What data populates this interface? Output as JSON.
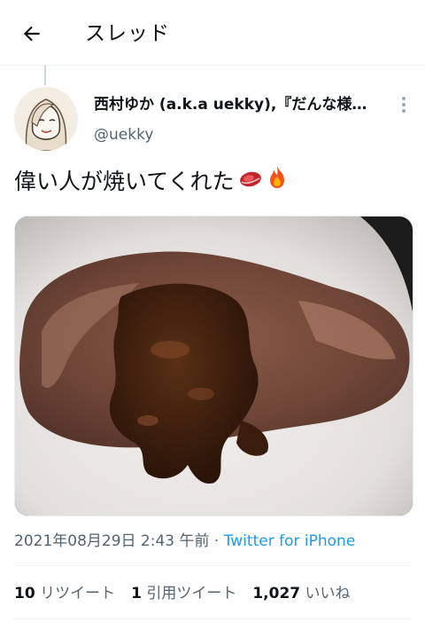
{
  "header": {
    "title": "スレッド",
    "back_icon": "arrow-left-icon"
  },
  "tweet": {
    "display_name": "西村ゆか (a.k.a uekky),『だんな様…",
    "handle": "@uekky",
    "text": "偉い人が焼いてくれた",
    "emojis": [
      "meat-icon",
      "fire-icon"
    ],
    "timestamp": "2021年08月29日 2:43 午前",
    "separator": " · ",
    "source": "Twitter for iPhone"
  },
  "stats": {
    "retweets_count": "10",
    "retweets_label": "リツイート",
    "quotes_count": "1",
    "quotes_label": "引用ツイート",
    "likes_count": "1,027",
    "likes_label": "いいね"
  },
  "colors": {
    "link": "#1d9bf0",
    "secondary_text": "#536471",
    "primary_text": "#0f1419",
    "divider": "#eff3f4"
  }
}
